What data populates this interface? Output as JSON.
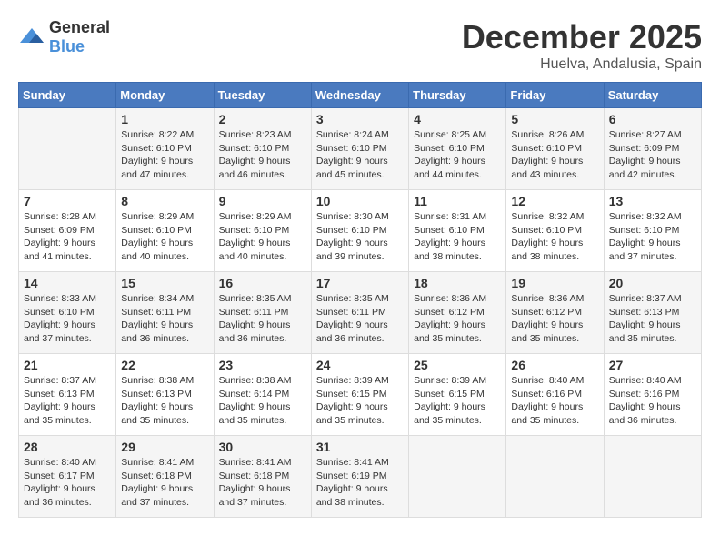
{
  "header": {
    "logo_general": "General",
    "logo_blue": "Blue",
    "month": "December 2025",
    "location": "Huelva, Andalusia, Spain"
  },
  "days_of_week": [
    "Sunday",
    "Monday",
    "Tuesday",
    "Wednesday",
    "Thursday",
    "Friday",
    "Saturday"
  ],
  "weeks": [
    [
      {
        "day": "",
        "info": ""
      },
      {
        "day": "1",
        "info": "Sunrise: 8:22 AM\nSunset: 6:10 PM\nDaylight: 9 hours\nand 47 minutes."
      },
      {
        "day": "2",
        "info": "Sunrise: 8:23 AM\nSunset: 6:10 PM\nDaylight: 9 hours\nand 46 minutes."
      },
      {
        "day": "3",
        "info": "Sunrise: 8:24 AM\nSunset: 6:10 PM\nDaylight: 9 hours\nand 45 minutes."
      },
      {
        "day": "4",
        "info": "Sunrise: 8:25 AM\nSunset: 6:10 PM\nDaylight: 9 hours\nand 44 minutes."
      },
      {
        "day": "5",
        "info": "Sunrise: 8:26 AM\nSunset: 6:10 PM\nDaylight: 9 hours\nand 43 minutes."
      },
      {
        "day": "6",
        "info": "Sunrise: 8:27 AM\nSunset: 6:09 PM\nDaylight: 9 hours\nand 42 minutes."
      }
    ],
    [
      {
        "day": "7",
        "info": "Sunrise: 8:28 AM\nSunset: 6:09 PM\nDaylight: 9 hours\nand 41 minutes."
      },
      {
        "day": "8",
        "info": "Sunrise: 8:29 AM\nSunset: 6:10 PM\nDaylight: 9 hours\nand 40 minutes."
      },
      {
        "day": "9",
        "info": "Sunrise: 8:29 AM\nSunset: 6:10 PM\nDaylight: 9 hours\nand 40 minutes."
      },
      {
        "day": "10",
        "info": "Sunrise: 8:30 AM\nSunset: 6:10 PM\nDaylight: 9 hours\nand 39 minutes."
      },
      {
        "day": "11",
        "info": "Sunrise: 8:31 AM\nSunset: 6:10 PM\nDaylight: 9 hours\nand 38 minutes."
      },
      {
        "day": "12",
        "info": "Sunrise: 8:32 AM\nSunset: 6:10 PM\nDaylight: 9 hours\nand 38 minutes."
      },
      {
        "day": "13",
        "info": "Sunrise: 8:32 AM\nSunset: 6:10 PM\nDaylight: 9 hours\nand 37 minutes."
      }
    ],
    [
      {
        "day": "14",
        "info": "Sunrise: 8:33 AM\nSunset: 6:10 PM\nDaylight: 9 hours\nand 37 minutes."
      },
      {
        "day": "15",
        "info": "Sunrise: 8:34 AM\nSunset: 6:11 PM\nDaylight: 9 hours\nand 36 minutes."
      },
      {
        "day": "16",
        "info": "Sunrise: 8:35 AM\nSunset: 6:11 PM\nDaylight: 9 hours\nand 36 minutes."
      },
      {
        "day": "17",
        "info": "Sunrise: 8:35 AM\nSunset: 6:11 PM\nDaylight: 9 hours\nand 36 minutes."
      },
      {
        "day": "18",
        "info": "Sunrise: 8:36 AM\nSunset: 6:12 PM\nDaylight: 9 hours\nand 35 minutes."
      },
      {
        "day": "19",
        "info": "Sunrise: 8:36 AM\nSunset: 6:12 PM\nDaylight: 9 hours\nand 35 minutes."
      },
      {
        "day": "20",
        "info": "Sunrise: 8:37 AM\nSunset: 6:13 PM\nDaylight: 9 hours\nand 35 minutes."
      }
    ],
    [
      {
        "day": "21",
        "info": "Sunrise: 8:37 AM\nSunset: 6:13 PM\nDaylight: 9 hours\nand 35 minutes."
      },
      {
        "day": "22",
        "info": "Sunrise: 8:38 AM\nSunset: 6:13 PM\nDaylight: 9 hours\nand 35 minutes."
      },
      {
        "day": "23",
        "info": "Sunrise: 8:38 AM\nSunset: 6:14 PM\nDaylight: 9 hours\nand 35 minutes."
      },
      {
        "day": "24",
        "info": "Sunrise: 8:39 AM\nSunset: 6:15 PM\nDaylight: 9 hours\nand 35 minutes."
      },
      {
        "day": "25",
        "info": "Sunrise: 8:39 AM\nSunset: 6:15 PM\nDaylight: 9 hours\nand 35 minutes."
      },
      {
        "day": "26",
        "info": "Sunrise: 8:40 AM\nSunset: 6:16 PM\nDaylight: 9 hours\nand 35 minutes."
      },
      {
        "day": "27",
        "info": "Sunrise: 8:40 AM\nSunset: 6:16 PM\nDaylight: 9 hours\nand 36 minutes."
      }
    ],
    [
      {
        "day": "28",
        "info": "Sunrise: 8:40 AM\nSunset: 6:17 PM\nDaylight: 9 hours\nand 36 minutes."
      },
      {
        "day": "29",
        "info": "Sunrise: 8:41 AM\nSunset: 6:18 PM\nDaylight: 9 hours\nand 37 minutes."
      },
      {
        "day": "30",
        "info": "Sunrise: 8:41 AM\nSunset: 6:18 PM\nDaylight: 9 hours\nand 37 minutes."
      },
      {
        "day": "31",
        "info": "Sunrise: 8:41 AM\nSunset: 6:19 PM\nDaylight: 9 hours\nand 38 minutes."
      },
      {
        "day": "",
        "info": ""
      },
      {
        "day": "",
        "info": ""
      },
      {
        "day": "",
        "info": ""
      }
    ]
  ]
}
